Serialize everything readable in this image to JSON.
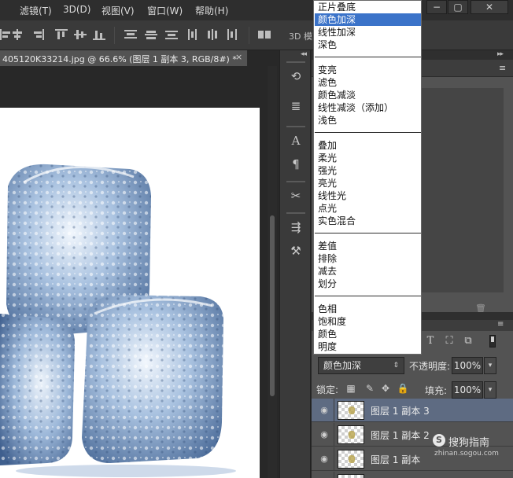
{
  "menubar": {
    "items": [
      "滤镜(T)",
      "3D(D)",
      "视图(V)",
      "窗口(W)",
      "帮助(H)"
    ],
    "window_controls": [
      "−",
      "▢",
      "✕"
    ]
  },
  "optionsbar": {
    "label_3d": "3D 模"
  },
  "document_tab": {
    "title": "405120K33214.jpg @ 66.6% (图层 1 副本 3, RGB/8#) *",
    "close": "×"
  },
  "blend_dropdown": {
    "groups": [
      [
        "正片叠底",
        "颜色加深",
        "线性加深",
        "深色"
      ],
      [
        "变亮",
        "滤色",
        "颜色减淡",
        "线性减淡（添加）",
        "浅色"
      ],
      [
        "叠加",
        "柔光",
        "强光",
        "亮光",
        "线性光",
        "点光",
        "实色混合"
      ],
      [
        "差值",
        "排除",
        "减去",
        "划分"
      ],
      [
        "色相",
        "饱和度",
        "颜色",
        "明度"
      ]
    ],
    "highlighted": "颜色加深"
  },
  "layers": {
    "blend_mode": "颜色加深",
    "opacity_label": "不透明度:",
    "opacity_value": "100%",
    "lock_label": "锁定:",
    "fill_label": "填充:",
    "fill_value": "100%",
    "rows": [
      {
        "name": "图层 1 副本 3",
        "selected": true
      },
      {
        "name": "图层 1 副本 2",
        "selected": false
      },
      {
        "name": "图层 1 副本",
        "selected": false
      }
    ]
  },
  "watermark": {
    "brand": "搜狗指南",
    "url": "zhinan.sogou.com",
    "badge": "S"
  },
  "colors": {
    "selected_layer": "#5e6b82",
    "dropdown_highlight": "#3b73c9",
    "panel_bg": "#535353",
    "ice_blue": "#6f93bf"
  }
}
